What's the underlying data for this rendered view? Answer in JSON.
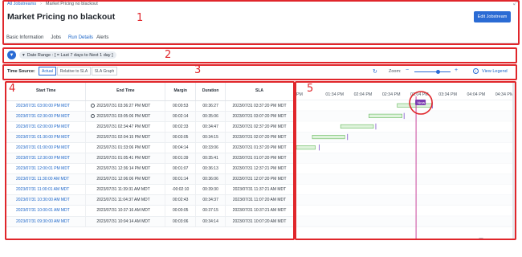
{
  "breadcrumb": {
    "root": "All Jobstreams",
    "current": "Market Pricing no blackout"
  },
  "page_title": "Market Pricing no blackout",
  "edit_button": "Edit Jobstream",
  "tabs": [
    "Basic Information",
    "Jobs",
    "Run Details",
    "Alerts"
  ],
  "active_tab": "Run Details",
  "filter": {
    "chip": "Date Range : [ = Last 7 days to Next 1 day ]"
  },
  "time_source": {
    "label": "Time Source:",
    "options": [
      "Actual",
      "Relative to SLA",
      "SLA Graph"
    ],
    "selected": "Actual"
  },
  "zoom": {
    "label": "Zoom:",
    "level": 0.65
  },
  "view_legend": "View Legend",
  "callouts": [
    "1",
    "2",
    "3",
    "4",
    "5"
  ],
  "table": {
    "headers": [
      "Start Time",
      "End Time",
      "Margin",
      "Duration",
      "SLA"
    ],
    "rows": [
      {
        "start": "2023/07/31 03:00:00 PM MDT",
        "end": "2023/07/31 03:36:27 PM MDT",
        "running": true,
        "margin": "00:00:53",
        "duration": "00:36:27",
        "sla": "2023/07/31 03:37:20 PM MDT"
      },
      {
        "start": "2023/07/31 02:30:00 PM MDT",
        "end": "2023/07/31 03:05:06 PM MDT",
        "running": true,
        "margin": "00:02:14",
        "duration": "00:35:06",
        "sla": "2023/07/31 03:07:20 PM MDT"
      },
      {
        "start": "2023/07/31 02:00:00 PM MDT",
        "end": "2023/07/31 02:34:47 PM MDT",
        "running": false,
        "margin": "00:02:33",
        "duration": "00:34:47",
        "sla": "2023/07/31 02:37:20 PM MDT"
      },
      {
        "start": "2023/07/31 01:30:00 PM MDT",
        "end": "2023/07/31 02:04:15 PM MDT",
        "running": false,
        "margin": "00:03:05",
        "duration": "00:34:15",
        "sla": "2023/07/31 02:07:20 PM MDT"
      },
      {
        "start": "2023/07/31 01:00:00 PM MDT",
        "end": "2023/07/31 01:33:06 PM MDT",
        "running": false,
        "margin": "00:04:14",
        "duration": "00:33:06",
        "sla": "2023/07/31 01:37:20 PM MDT"
      },
      {
        "start": "2023/07/31 12:30:00 PM MDT",
        "end": "2023/07/31 01:05:41 PM MDT",
        "running": false,
        "margin": "00:01:39",
        "duration": "00:35:41",
        "sla": "2023/07/31 01:07:20 PM MDT"
      },
      {
        "start": "2023/07/31 12:00:01 PM MDT",
        "end": "2023/07/31 12:36:14 PM MDT",
        "running": false,
        "margin": "00:01:07",
        "duration": "00:36:13",
        "sla": "2023/07/31 12:37:21 PM MDT"
      },
      {
        "start": "2023/07/31 11:30:00 AM MDT",
        "end": "2023/07/31 12:06:06 PM MDT",
        "running": false,
        "margin": "00:01:14",
        "duration": "00:36:06",
        "sla": "2023/07/31 12:07:20 PM MDT"
      },
      {
        "start": "2023/07/31 11:00:01 AM MDT",
        "end": "2023/07/31 11:39:31 AM MDT",
        "running": false,
        "margin": "-00:02:10",
        "duration": "00:39:30",
        "sla": "2023/07/31 11:37:21 AM MDT"
      },
      {
        "start": "2023/07/31 10:30:00 AM MDT",
        "end": "2023/07/31 11:04:37 AM MDT",
        "running": false,
        "margin": "00:02:43",
        "duration": "00:34:37",
        "sla": "2023/07/31 11:07:20 AM MDT"
      },
      {
        "start": "2023/07/31 10:00:01 AM MDT",
        "end": "2023/07/31 10:37:16 AM MDT",
        "running": false,
        "margin": "00:00:05",
        "duration": "00:37:15",
        "sla": "2023/07/31 10:37:21 AM MDT"
      },
      {
        "start": "2023/07/31 09:30:00 AM MDT",
        "end": "2023/07/31 10:04:14 AM MDT",
        "running": false,
        "margin": "00:03:06",
        "duration": "00:34:14",
        "sla": "2023/07/31 10:07:20 AM MDT"
      }
    ]
  },
  "gantt": {
    "axis_labels": [
      "PM",
      "01:34 PM",
      "02:04 PM",
      "02:34 PM",
      "03:04 PM",
      "03:34 PM",
      "04:04 PM",
      "04:34 PM",
      "05:04 PM"
    ],
    "axis_start_min": 793,
    "axis_minutes_visible": 230,
    "now_label": "Now",
    "now_min": 920,
    "bars": [
      {
        "start_min": 900,
        "end_min": 936.5,
        "sla_min": 937.3
      },
      {
        "start_min": 870,
        "end_min": 905.1,
        "sla_min": 907.3
      },
      {
        "start_min": 840,
        "end_min": 874.8,
        "sla_min": 877.3
      },
      {
        "start_min": 810,
        "end_min": 844.3,
        "sla_min": 847.3
      },
      {
        "start_min": 780,
        "end_min": 813.1,
        "sla_min": 817.3
      }
    ],
    "colors": {
      "bar_fill": "#dff3dc",
      "bar_border": "#64b85c",
      "sla_marker": "#7a4fc7",
      "now_line": "#c9449a",
      "now_badge": "#7a3bb0",
      "highlight": "#e0262b"
    }
  }
}
